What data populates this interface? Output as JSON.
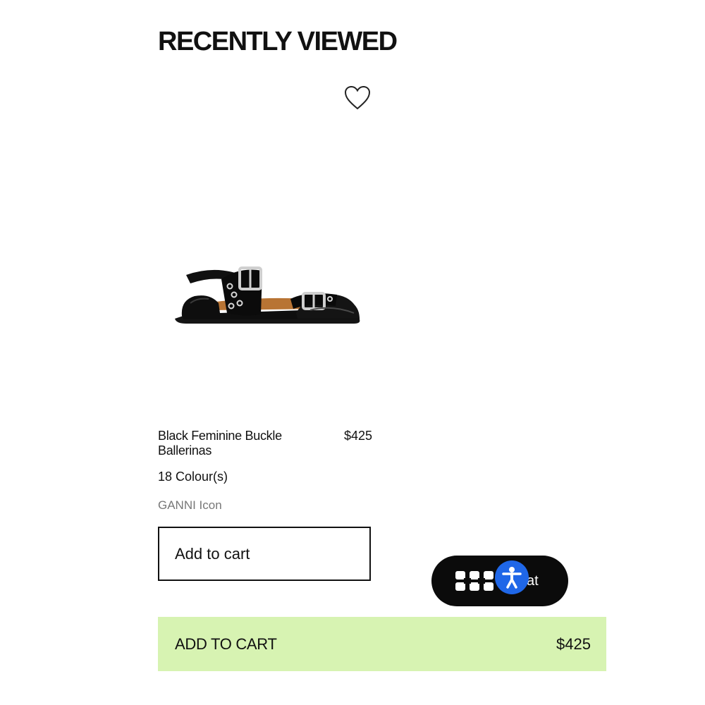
{
  "section": {
    "title": "RECENTLY VIEWED"
  },
  "product": {
    "name": "Black Feminine Buckle Ballerinas",
    "price": "$425",
    "colours": "18 Colour(s)",
    "collection": "GANNI Icon",
    "add_to_cart_label": "Add to cart",
    "image_alt": "black buckle ballerina shoe",
    "wishlist_icon": "heart-outline-icon"
  },
  "chat_widget": {
    "label": "at",
    "icon": "chat-logo-icon"
  },
  "accessibility": {
    "icon": "accessibility-person-icon",
    "color": "#1f67e8"
  },
  "sticky_cart": {
    "label": "ADD TO CART",
    "price": "$425",
    "color": "#d7f3b2"
  }
}
